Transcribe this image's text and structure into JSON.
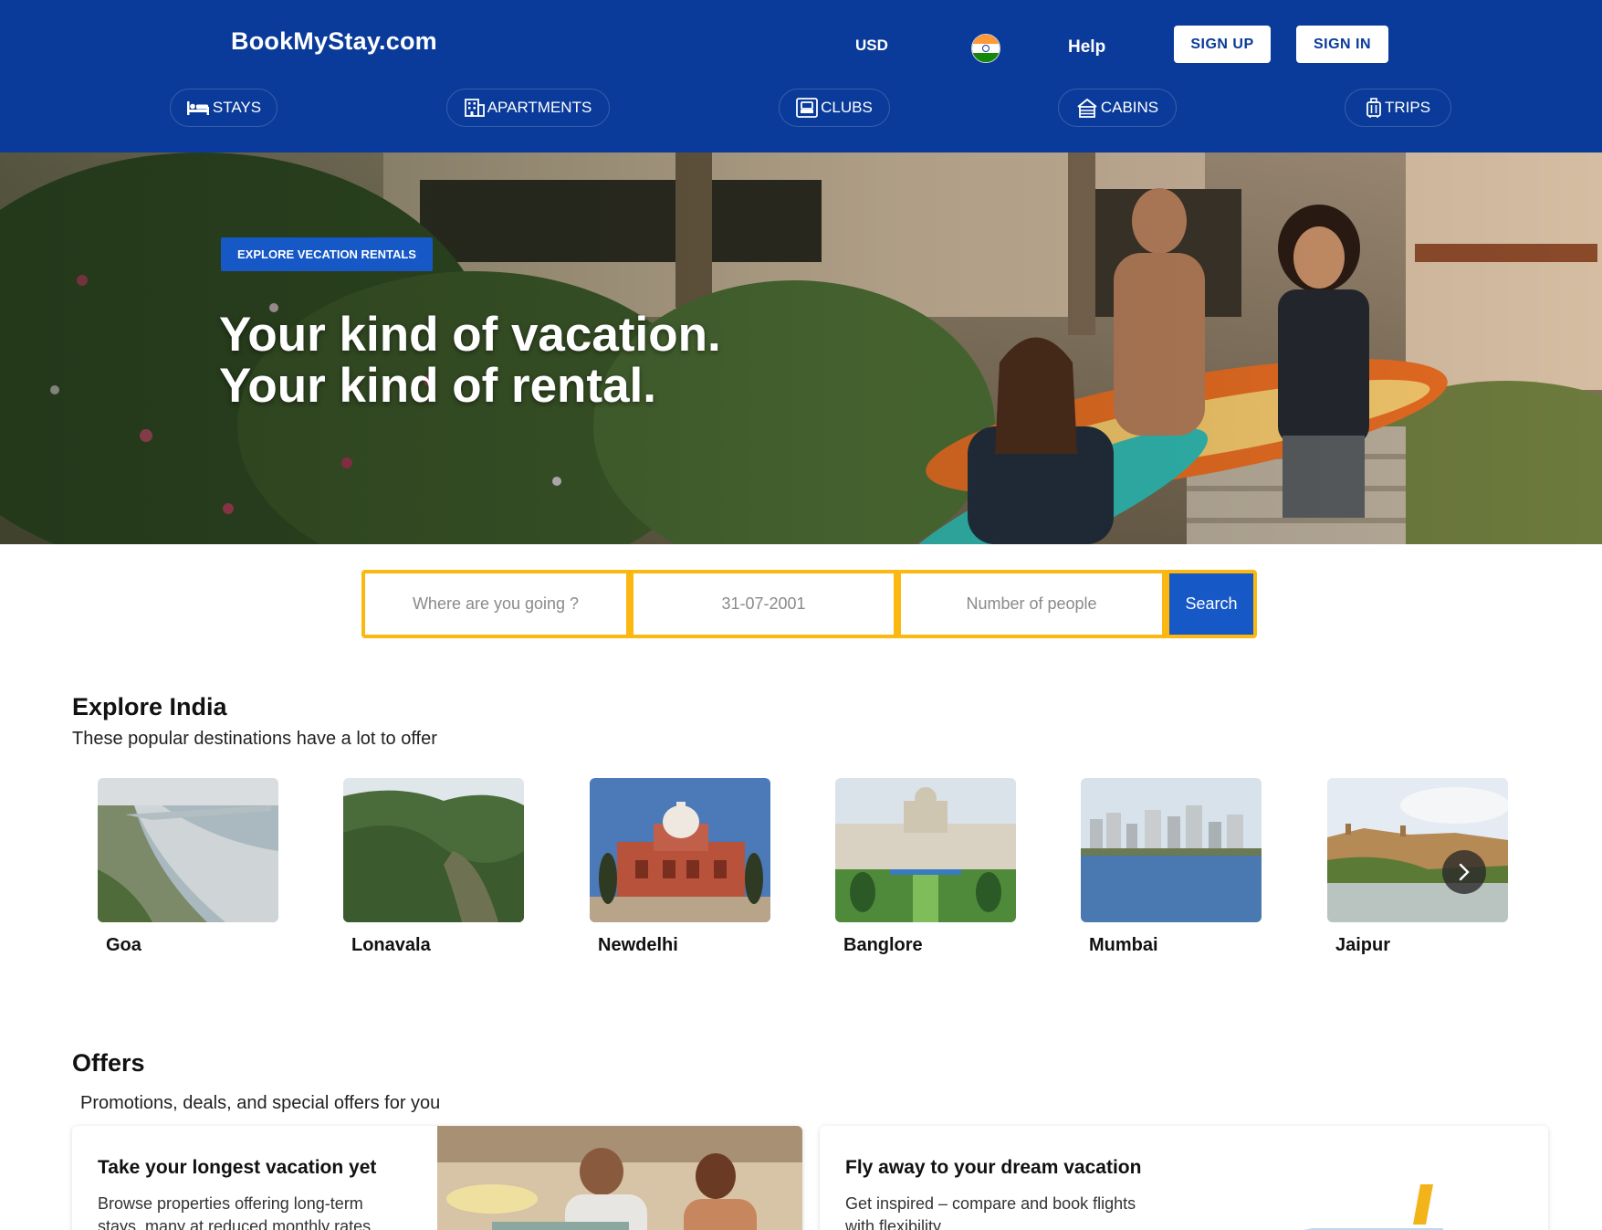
{
  "header": {
    "brand": "BookMyStay.com",
    "currency": "USD",
    "help": "Help",
    "sign_up": "SIGN UP",
    "sign_in": "SIGN IN",
    "background_color": "#0a3b9a",
    "nav": [
      {
        "label": "STAYS",
        "icon": "bed-icon"
      },
      {
        "label": "APARTMENTS",
        "icon": "building-icon"
      },
      {
        "label": "CLUBS",
        "icon": "club-icon"
      },
      {
        "label": "CABINS",
        "icon": "cabin-icon"
      },
      {
        "label": "TRIPS",
        "icon": "luggage-icon"
      }
    ]
  },
  "hero": {
    "badge": "EXPLORE VECATION RENTALS",
    "headline_line1": "Your kind of vacation.",
    "headline_line2": "Your kind of rental."
  },
  "search": {
    "destination_placeholder": "Where are you going ?",
    "date_placeholder": "31-07-2001",
    "people_placeholder": "Number of people",
    "button": "Search",
    "border_color": "#fbb811",
    "button_color": "#1558c6"
  },
  "explore": {
    "title": "Explore India",
    "subtitle": "These popular destinations have a lot to offer",
    "destinations": [
      {
        "name": "Goa"
      },
      {
        "name": "Lonavala"
      },
      {
        "name": "Newdelhi"
      },
      {
        "name": "Banglore"
      },
      {
        "name": "Mumbai"
      },
      {
        "name": "Jaipur"
      }
    ]
  },
  "offers": {
    "title": "Offers",
    "subtitle": "Promotions, deals, and special offers for you",
    "cards": [
      {
        "heading": "Take your longest vacation yet",
        "text": "Browse properties offering long-term stays, many at reduced monthly rates."
      },
      {
        "heading": "Fly away to your dream vacation",
        "text": "Get inspired – compare and book flights with flexibility"
      }
    ]
  }
}
